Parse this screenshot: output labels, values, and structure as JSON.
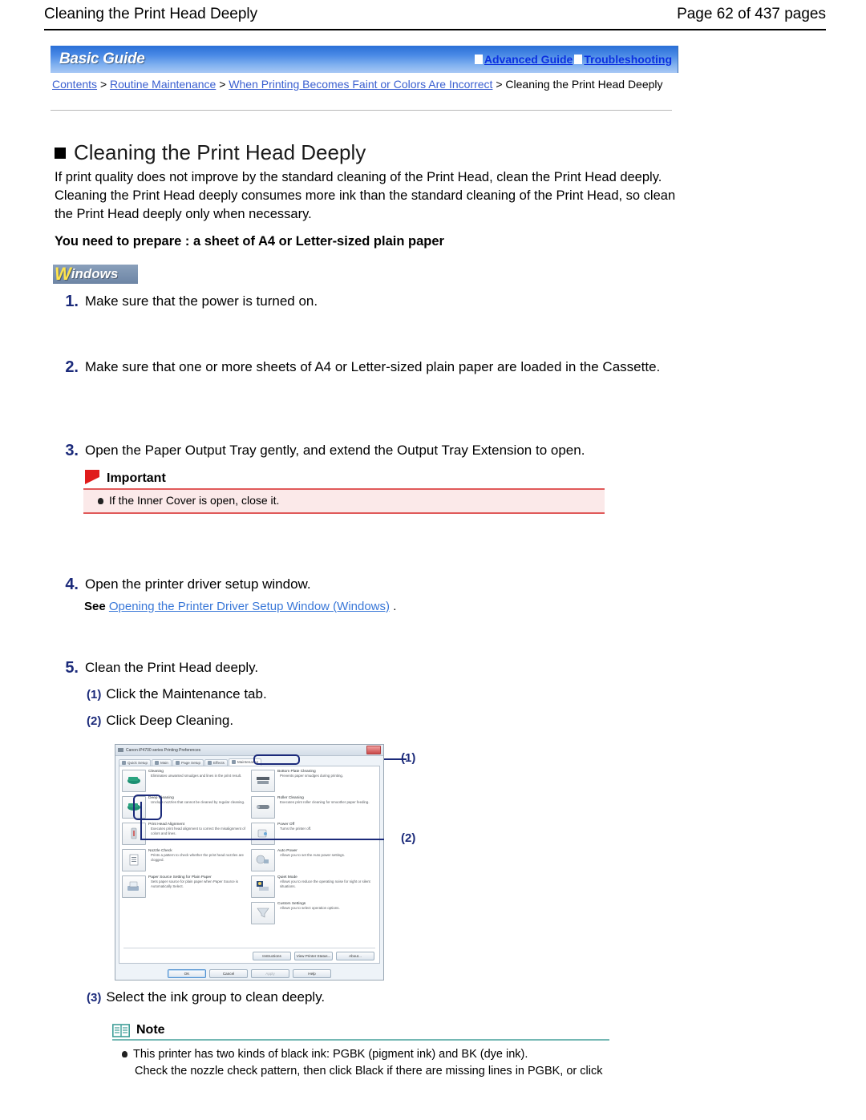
{
  "page_header": {
    "title": "Cleaning the Print Head Deeply",
    "pages": "Page 62 of 437 pages"
  },
  "guide_bar": {
    "brand": "Basic Guide",
    "links": [
      {
        "label": "Advanced Guide"
      },
      {
        "label": "Troubleshooting"
      }
    ]
  },
  "breadcrumb": {
    "items": [
      {
        "label": "Contents",
        "link": true
      },
      {
        "label": "Routine Maintenance",
        "link": true
      },
      {
        "label": "When Printing Becomes Faint or Colors Are Incorrect",
        "link": true
      },
      {
        "label": "Cleaning the Print Head Deeply",
        "link": false
      }
    ],
    "separator": ">"
  },
  "content": {
    "heading": "Cleaning the Print Head Deeply",
    "intro": "If print quality does not improve by the standard cleaning of the Print Head, clean the Print Head deeply. Cleaning the Print Head deeply consumes more ink than the standard cleaning of the Print Head, so clean the Print Head deeply only when necessary.",
    "prepare": "You need to prepare : a sheet of A4 or Letter-sized plain paper",
    "os_badge": {
      "first_letter": "W",
      "rest": "indows"
    },
    "steps": [
      {
        "num": "1.",
        "text": "Make sure that the power is turned on."
      },
      {
        "num": "2.",
        "text": "Make sure that one or more sheets of A4 or Letter-sized plain paper are loaded in the Cassette."
      },
      {
        "num": "3.",
        "text": "Open the Paper Output Tray gently, and extend the Output Tray Extension to open."
      },
      {
        "num": "4.",
        "text": "Open the printer driver setup window."
      },
      {
        "num": "5.",
        "text": "Clean the Print Head deeply."
      }
    ],
    "see_line": {
      "label": "See",
      "link": "Opening the Printer Driver Setup Window (Windows)",
      "period": "."
    },
    "important": {
      "title": "Important",
      "items": [
        "If the Inner Cover is open, close it."
      ]
    },
    "substeps": [
      {
        "marker": "(1)",
        "text": "Click the Maintenance tab."
      },
      {
        "marker": "(2)",
        "text": "Click Deep Cleaning."
      },
      {
        "marker": "(3)",
        "text": "Select the ink group to clean deeply."
      }
    ],
    "note": {
      "title": "Note",
      "line1": "This printer has two kinds of black ink: PGBK (pigment ink) and BK (dye ink).",
      "line2": "Check the nozzle check pattern, then click Black if there are missing lines in PGBK, or click"
    },
    "callouts": [
      {
        "label": "(1)"
      },
      {
        "label": "(2)"
      }
    ]
  },
  "screenshot": {
    "window_title": "Canon iP4700 series Printing Preferences",
    "tabs": [
      {
        "label": "Quick Setup"
      },
      {
        "label": "Main"
      },
      {
        "label": "Page Setup"
      },
      {
        "label": "Effects"
      },
      {
        "label": "Maintenance"
      }
    ],
    "features_left": [
      {
        "title": "Cleaning",
        "desc": "Eliminates unwanted smudges and lines in the print result."
      },
      {
        "title": "Deep Cleaning",
        "desc": "Unclogs nozzles that cannot be cleaned by regular cleaning."
      },
      {
        "title": "Print Head Alignment",
        "desc": "Executes print head alignment to correct the misalignment of colors and lines."
      },
      {
        "title": "Nozzle Check",
        "desc": "Prints a pattern to check whether the print head nozzles are clogged."
      },
      {
        "title": "Paper Source Setting for Plain Paper",
        "desc": "Sets paper source for plain paper when Paper Source is Automatically Select."
      }
    ],
    "features_right": [
      {
        "title": "Bottom Plate Cleaning",
        "desc": "Prevents paper smudges during printing."
      },
      {
        "title": "Roller Cleaning",
        "desc": "Executes print roller cleaning for smoother paper feeding."
      },
      {
        "title": "Power Off",
        "desc": "Turns the printer off."
      },
      {
        "title": "Auto Power",
        "desc": "Allows you to set the Auto power settings."
      },
      {
        "title": "Quiet Mode",
        "desc": "Allows you to reduce the operating noise for night or silent situations."
      },
      {
        "title": "Custom Settings",
        "desc": "Allows you to select operation options."
      }
    ],
    "aux_buttons": [
      {
        "label": "Instructions"
      },
      {
        "label": "View Printer Status..."
      },
      {
        "label": "About..."
      }
    ],
    "dialog_buttons": [
      {
        "label": "OK",
        "state": "default"
      },
      {
        "label": "Cancel",
        "state": "normal"
      },
      {
        "label": "Apply",
        "state": "disabled"
      },
      {
        "label": "Help",
        "state": "normal"
      }
    ]
  },
  "colors": {
    "accent_blue": "#1b2a7a",
    "link_blue": "#3a5fd0",
    "guide_blue": "#0a2fe0",
    "important_red": "#e05a5a",
    "note_teal": "#74b8b4"
  }
}
